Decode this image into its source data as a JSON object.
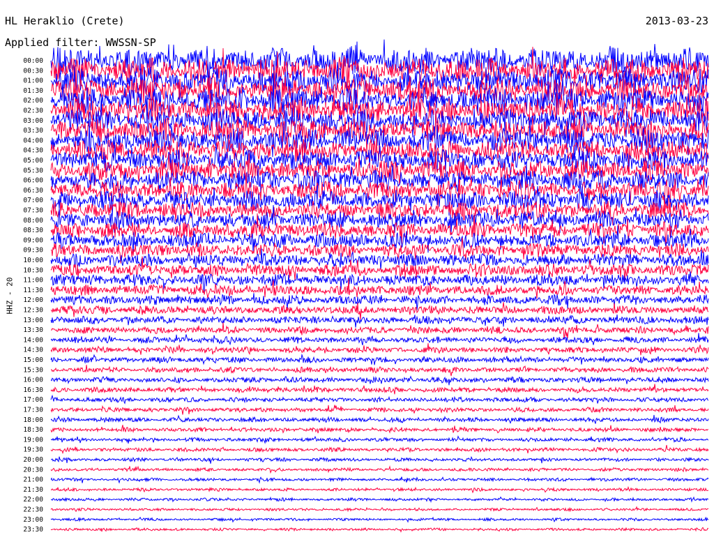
{
  "header": {
    "station": "HL Heraklio (Crete)",
    "date": "2013-03-23",
    "filter": "Applied filter: WWSSN-SP"
  },
  "channel_label": "HHZ - 20",
  "colors": {
    "blue": "#0000ff",
    "red": "#ff0040",
    "background": "#ffffff"
  },
  "chart_data": {
    "type": "line",
    "description_kind": "helicorder",
    "y_tick_labels": [
      "00:00",
      "00:30",
      "01:00",
      "01:30",
      "02:00",
      "02:30",
      "03:00",
      "03:30",
      "04:00",
      "04:30",
      "05:00",
      "05:30",
      "06:00",
      "06:30",
      "07:00",
      "07:30",
      "08:00",
      "08:30",
      "09:00",
      "09:30",
      "10:00",
      "10:30",
      "11:00",
      "11:30",
      "12:00",
      "12:30",
      "13:00",
      "13:30",
      "14:00",
      "14:30",
      "15:00",
      "15:30",
      "16:00",
      "16:30",
      "17:00",
      "17:30",
      "18:00",
      "18:30",
      "19:00",
      "19:30",
      "20:00",
      "20:30",
      "21:00",
      "21:30",
      "22:00",
      "22:30",
      "23:00",
      "23:30"
    ],
    "trace_colors": [
      "#0000ff",
      "#ff0040"
    ],
    "relative_amplitude": [
      4.2,
      4.0,
      3.9,
      3.8,
      3.8,
      3.7,
      3.6,
      3.5,
      3.5,
      3.4,
      3.3,
      3.2,
      3.1,
      3.0,
      2.9,
      2.7,
      2.6,
      2.4,
      2.3,
      2.1,
      2.0,
      1.9,
      1.8,
      1.6,
      1.5,
      1.3,
      1.2,
      1.1,
      1.0,
      0.95,
      0.9,
      0.85,
      0.85,
      0.8,
      0.75,
      0.7,
      0.7,
      0.65,
      0.6,
      0.6,
      0.55,
      0.5,
      0.5,
      0.45,
      0.45,
      0.4,
      0.4,
      0.4
    ]
  }
}
